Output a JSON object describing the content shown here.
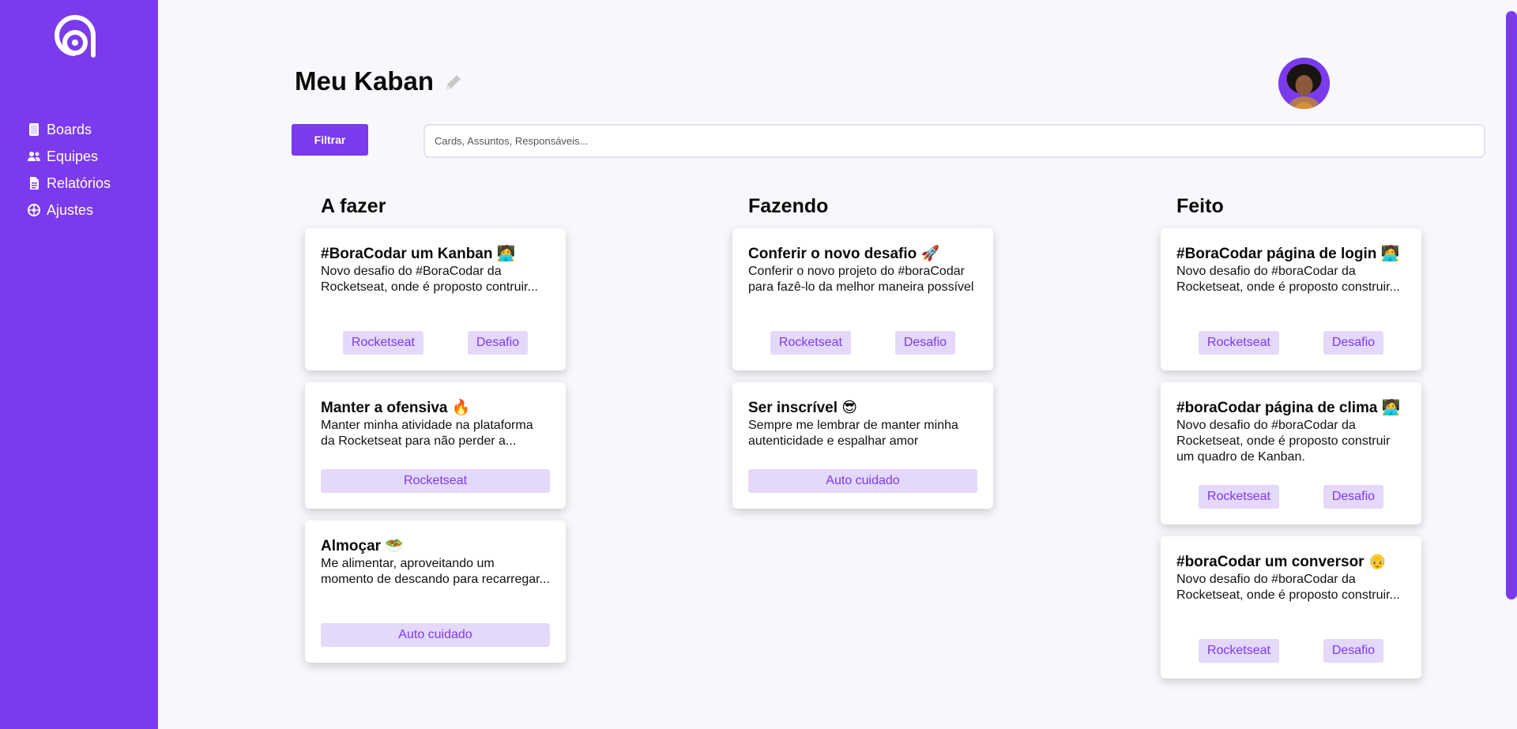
{
  "sidebar": {
    "logo": "rocketseat-logo",
    "items": [
      {
        "label": "Boards",
        "icon": "boards-icon"
      },
      {
        "label": "Equipes",
        "icon": "users-icon"
      },
      {
        "label": "Relatórios",
        "icon": "document-icon"
      },
      {
        "label": "Ajustes",
        "icon": "settings-icon"
      }
    ]
  },
  "header": {
    "title": "Meu Kaban",
    "filter_label": "Filtrar",
    "search_placeholder": "Cards, Assuntos, Responsáveis..."
  },
  "columns": [
    {
      "title": "A fazer",
      "cards": [
        {
          "title": "#BoraCodar um Kanban 🧑‍💻",
          "description": "Novo desafio do #BoraCodar da Rocketseat, onde é proposto contruir...",
          "tags": [
            "Rocketseat",
            "Desafio"
          ]
        },
        {
          "title": "Manter a ofensiva 🔥",
          "description": "Manter minha atividade na plataforma da Rocketseat para não perder a...",
          "tags": [
            "Rocketseat"
          ]
        },
        {
          "title": "Almoçar 🥗",
          "description": "Me alimentar, aproveitando um momento de descando para recarregar...",
          "tags": [
            "Auto cuidado"
          ]
        }
      ]
    },
    {
      "title": "Fazendo",
      "cards": [
        {
          "title": "Conferir o novo desafio 🚀",
          "description": "Conferir o novo projeto do #boraCodar para fazê-lo da melhor maneira possível",
          "tags": [
            "Rocketseat",
            "Desafio"
          ]
        },
        {
          "title": "Ser inscrível 😎",
          "description": "Sempre me lembrar de manter minha autenticidade e espalhar amor",
          "tags": [
            "Auto cuidado"
          ]
        }
      ]
    },
    {
      "title": "Feito",
      "cards": [
        {
          "title": "#BoraCodar página de login 🧑‍💻",
          "description": "Novo desafio do #boraCodar da Rocketseat, onde é proposto construir...",
          "tags": [
            "Rocketseat",
            "Desafio"
          ]
        },
        {
          "title": "#boraCodar página de clima 🧑‍💻",
          "description": "Novo desafio do #boraCodar da Rocketseat, onde é proposto construir um quadro de Kanban.",
          "tags": [
            "Rocketseat",
            "Desafio"
          ]
        },
        {
          "title": "#boraCodar um conversor 👴",
          "description": "Novo desafio do #boraCodar da Rocketseat, onde é proposto construir...",
          "tags": [
            "Rocketseat",
            "Desafio"
          ]
        }
      ]
    }
  ],
  "colors": {
    "accent": "#7c3aed",
    "tag_bg": "#e4d8fb",
    "background": "#f8f7fc"
  }
}
